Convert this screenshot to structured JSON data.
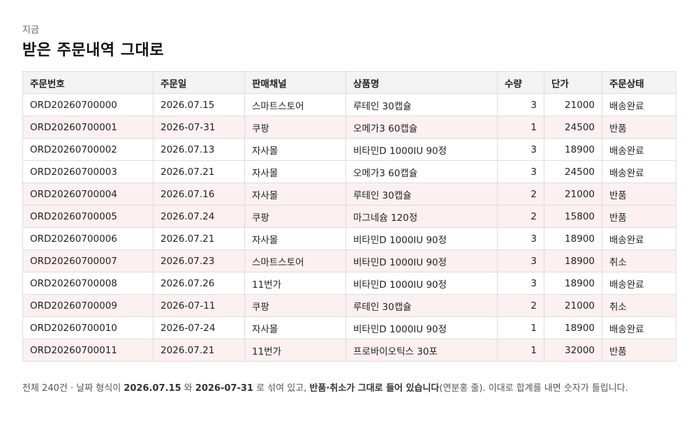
{
  "header": {
    "eyebrow": "지금",
    "title": "받은 주문내역 그대로"
  },
  "table": {
    "columns": [
      "주문번호",
      "주문일",
      "판매채널",
      "상품명",
      "수량",
      "단가",
      "주문상태"
    ],
    "rows": [
      [
        "ORD20260700000",
        "2026.07.15",
        "스마트스토어",
        "루테인 30캡슐",
        "3",
        "21000",
        "배송완료"
      ],
      [
        "ORD20260700001",
        "2026-07-31",
        "쿠팡",
        "오메가3 60캡슐",
        "1",
        "24500",
        "반품"
      ],
      [
        "ORD20260700002",
        "2026.07.13",
        "자사몰",
        "비타민D 1000IU 90정",
        "3",
        "18900",
        "배송완료"
      ],
      [
        "ORD20260700003",
        "2026.07.21",
        "자사몰",
        "오메가3 60캡슐",
        "3",
        "24500",
        "배송완료"
      ],
      [
        "ORD20260700004",
        "2026.07.16",
        "자사몰",
        "루테인 30캡슐",
        "2",
        "21000",
        "반품"
      ],
      [
        "ORD20260700005",
        "2026.07.24",
        "쿠팡",
        "마그네슘 120정",
        "2",
        "15800",
        "반품"
      ],
      [
        "ORD20260700006",
        "2026.07.21",
        "자사몰",
        "비타민D 1000IU 90정",
        "3",
        "18900",
        "배송완료"
      ],
      [
        "ORD20260700007",
        "2026.07.23",
        "스마트스토어",
        "비타민D 1000IU 90정",
        "3",
        "18900",
        "취소"
      ],
      [
        "ORD20260700008",
        "2026.07.26",
        "11번가",
        "비타민D 1000IU 90정",
        "3",
        "18900",
        "배송완료"
      ],
      [
        "ORD20260700009",
        "2026-07-11",
        "쿠팡",
        "루테인 30캡슐",
        "2",
        "21000",
        "취소"
      ],
      [
        "ORD20260700010",
        "2026-07-24",
        "자사몰",
        "비타민D 1000IU 90정",
        "1",
        "18900",
        "배송완료"
      ],
      [
        "ORD20260700011",
        "2026.07.21",
        "11번가",
        "프로바이오틱스 30포",
        "1",
        "32000",
        "반품"
      ]
    ],
    "highlighted_statuses": [
      "반품",
      "취소"
    ]
  },
  "footnote": {
    "t1": "전체 240건 · 날짜 형식이 ",
    "b1": "2026.07.15",
    "t2": " 와 ",
    "b2": "2026-07-31",
    "t3": " 로 섞여 있고, ",
    "b3": "반품·취소가 그대로 들어 있습니다",
    "t4": "(연분홍 줄). 이대로 합계를 내면 숫자가 틀립니다."
  },
  "colors": {
    "highlight_row": "#fdf0f1",
    "header_bg": "#f3f3f3",
    "border": "#dddddd"
  }
}
